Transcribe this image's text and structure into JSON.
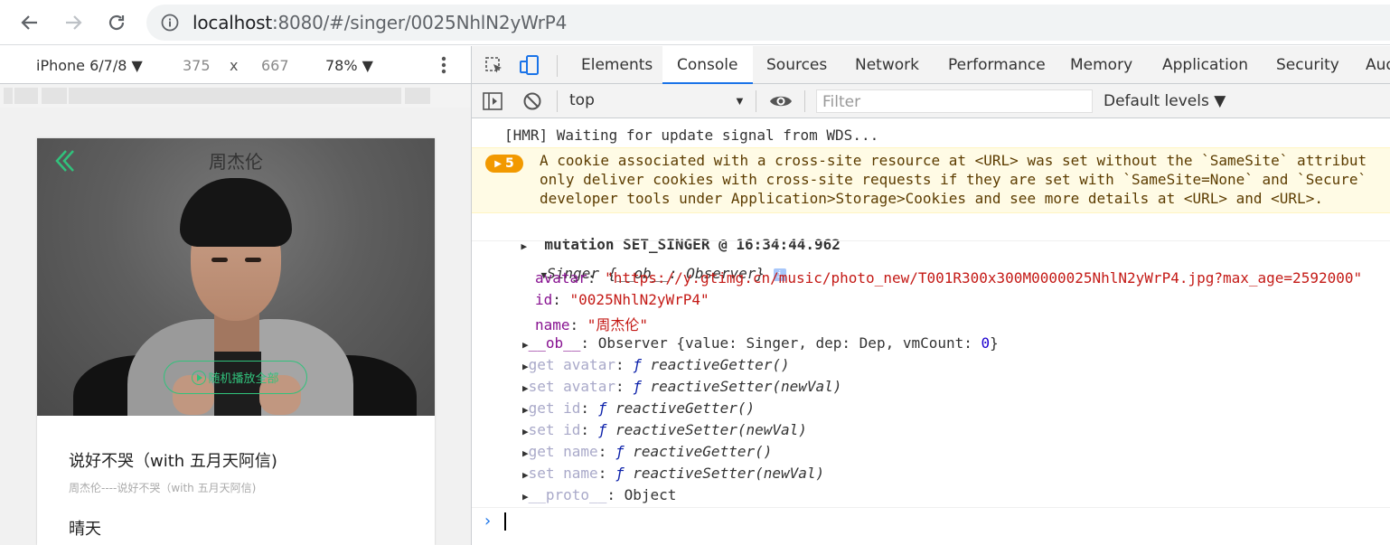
{
  "browser": {
    "url_host": "localhost",
    "url_rest": ":8080/#/singer/0025NhlN2yWrP4"
  },
  "device_toolbar": {
    "device": "iPhone 6/7/8 ▼",
    "width": "375",
    "times": "x",
    "height": "667",
    "zoom": "78% ▼"
  },
  "phone": {
    "singer_name": "周杰伦",
    "play_all_label": "随机播放全部",
    "songs": [
      {
        "name": "说好不哭（with 五月天阿信)",
        "desc": "周杰伦----说好不哭（with 五月天阿信)"
      },
      {
        "name": "晴天",
        "desc": ""
      }
    ]
  },
  "devtools": {
    "tabs": [
      "Elements",
      "Console",
      "Sources",
      "Network",
      "Performance",
      "Memory",
      "Application",
      "Security",
      "Aud"
    ],
    "active_tab": "Console",
    "context": "top",
    "filter_placeholder": "Filter",
    "levels": "Default levels ▼"
  },
  "console": {
    "hmr": "[HMR] Waiting for update signal from WDS...",
    "warn_count": "5",
    "warn_lines": [
      "A cookie associated with a cross-site resource at <URL> was set without the `SameSite` attribut",
      "only deliver cookies with cross-site requests if they are set with `SameSite=None` and `Secure`",
      "developer tools under Application>Storage>Cookies and see more details at <URL> and <URL>."
    ],
    "mutation": "mutation SET_SINGER @ 16:34:44.962",
    "object_head": "Singer {__ob__: Observer}",
    "avatar_key": "avatar",
    "avatar_val": "\"https://y.gtimg.cn/music/photo_new/T001R300x300M0000025NhlN2yWrP4.jpg?max_age=2592000\"",
    "id_key": "id",
    "id_val": "\"0025NhlN2yWrP4\"",
    "name_key": "name",
    "name_val": "\"周杰伦\"",
    "ob_key": "__ob__",
    "ob_val": "Observer {value: Singer, dep: Dep, vmCount: ",
    "ob_count": "0",
    "ob_close": "}",
    "accessors": [
      {
        "key": "get avatar",
        "val": "reactiveGetter()"
      },
      {
        "key": "set avatar",
        "val": "reactiveSetter(newVal)"
      },
      {
        "key": "get id",
        "val": "reactiveGetter()"
      },
      {
        "key": "set id",
        "val": "reactiveSetter(newVal)"
      },
      {
        "key": "get name",
        "val": "reactiveGetter()"
      },
      {
        "key": "set name",
        "val": "reactiveSetter(newVal)"
      }
    ],
    "proto_key": "__proto__",
    "proto_val": "Object"
  }
}
